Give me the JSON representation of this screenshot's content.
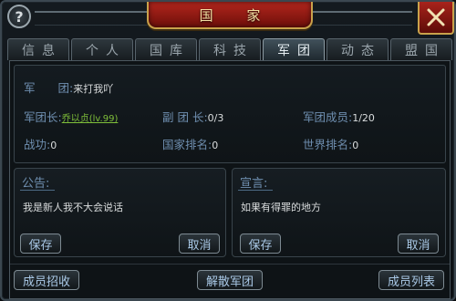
{
  "window": {
    "title": "国 家"
  },
  "tabs": [
    "信息",
    "个人",
    "国库",
    "科技",
    "军团",
    "动态",
    "盟国"
  ],
  "active_tab": 4,
  "legion": {
    "name_label": "军　　团:",
    "name_value": "来打我吖",
    "leader_label": "军团长:",
    "leader_value": "乔以贞(lv.99)",
    "vice_label": "副 团 长:",
    "vice_value": "0/3",
    "members_label": "军团成员:",
    "members_value": "1/20",
    "merit_label": "战功:",
    "merit_value": "0",
    "country_rank_label": "国家排名:",
    "country_rank_value": "0",
    "world_rank_label": "世界排名:",
    "world_rank_value": "0"
  },
  "notice": {
    "title": "公告:",
    "text": "我是新人我不大会说话",
    "save": "保存",
    "cancel": "取消"
  },
  "declaration": {
    "title": "宣言:",
    "text": "如果有得罪的地方",
    "save": "保存",
    "cancel": "取消"
  },
  "footer": {
    "recruit": "成员招收",
    "disband": "解散军团",
    "member_list": "成员列表"
  },
  "colors": {
    "title_red": "#b3261d",
    "gold_trim": "#c9a24b",
    "label_blue": "#6f8fb0",
    "leader_green": "#7fbf3a"
  }
}
